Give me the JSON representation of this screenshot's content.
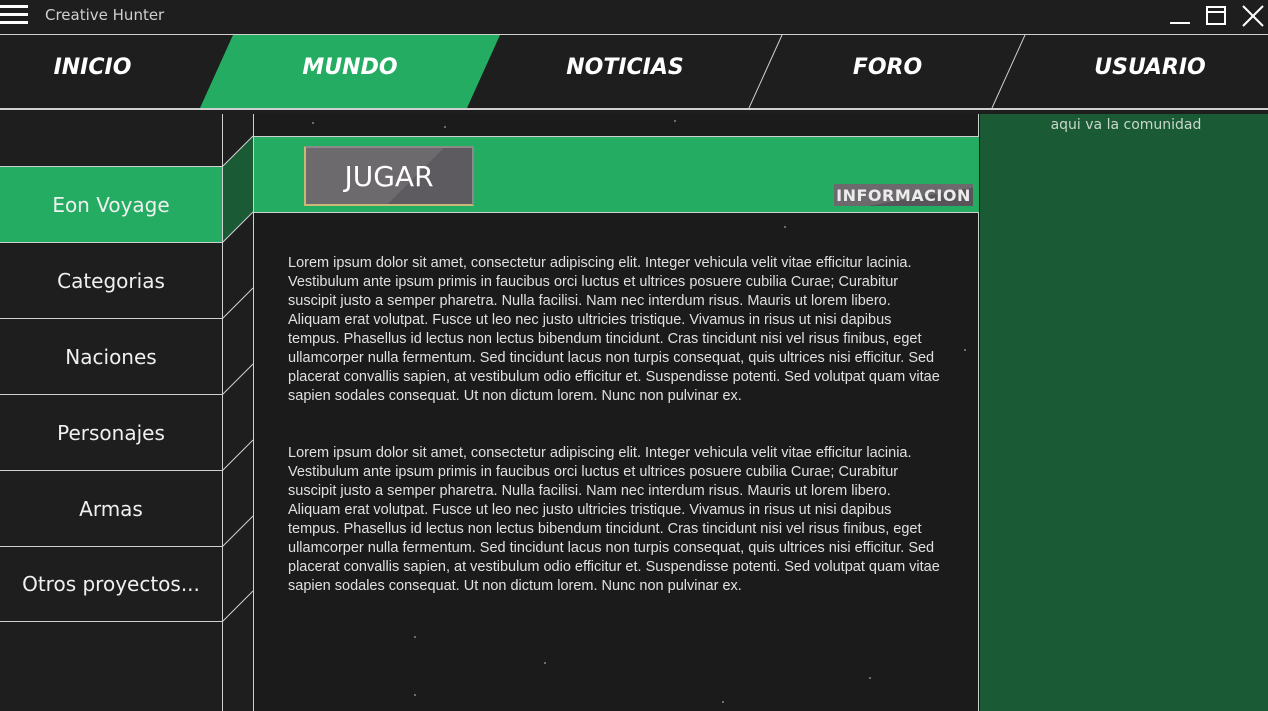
{
  "app": {
    "title": "Creative Hunter"
  },
  "nav": {
    "items": [
      {
        "label": "INICIO"
      },
      {
        "label": "MUNDO"
      },
      {
        "label": "NOTICIAS"
      },
      {
        "label": "FORO"
      },
      {
        "label": "USUARIO"
      }
    ],
    "active": "MUNDO"
  },
  "sidebar": {
    "items": [
      {
        "label": "Eon Voyage"
      },
      {
        "label": "Categorias"
      },
      {
        "label": "Naciones"
      },
      {
        "label": "Personajes"
      },
      {
        "label": "Armas"
      },
      {
        "label": "Otros proyectos..."
      }
    ],
    "active": "Eon Voyage"
  },
  "main": {
    "play_label": "JUGAR",
    "info_label": "INFORMACION",
    "paragraphs": [
      "Lorem ipsum dolor sit amet, consectetur adipiscing elit. Integer vehicula velit vitae efficitur lacinia. Vestibulum ante ipsum primis in faucibus orci luctus et ultrices posuere cubilia Curae; Curabitur suscipit justo a semper pharetra. Nulla facilisi. Nam nec interdum risus. Mauris ut lorem libero. Aliquam erat volutpat. Fusce ut leo nec justo ultricies tristique. Vivamus in risus ut nisi dapibus tempus. Phasellus id lectus non lectus bibendum tincidunt. Cras tincidunt nisi vel risus finibus, eget ullamcorper nulla fermentum. Sed tincidunt lacus non turpis consequat, quis ultrices nisi efficitur. Sed placerat convallis sapien, at vestibulum odio efficitur et. Suspendisse potenti. Sed volutpat quam vitae sapien sodales consequat. Ut non dictum lorem. Nunc non pulvinar ex.",
      "Lorem ipsum dolor sit amet, consectetur adipiscing elit. Integer vehicula velit vitae efficitur lacinia. Vestibulum ante ipsum primis in faucibus orci luctus et ultrices posuere cubilia Curae; Curabitur suscipit justo a semper pharetra. Nulla facilisi. Nam nec interdum risus. Mauris ut lorem libero. Aliquam erat volutpat. Fusce ut leo nec justo ultricies tristique. Vivamus in risus ut nisi dapibus tempus. Phasellus id lectus non lectus bibendum tincidunt. Cras tincidunt nisi vel risus finibus, eget ullamcorper nulla fermentum. Sed tincidunt lacus non turpis consequat, quis ultrices nisi efficitur. Sed placerat convallis sapien, at vestibulum odio efficitur et. Suspendisse potenti. Sed volutpat quam vitae sapien sodales consequat. Ut non dictum lorem. Nunc non pulvinar ex."
    ]
  },
  "community": {
    "text": "aqui va la comunidad"
  },
  "icons": {
    "menu": "hamburger-icon",
    "minimize": "minimize-icon",
    "maximize": "maximize-icon",
    "close": "close-icon"
  },
  "colors": {
    "accent": "#24ad62",
    "background": "#1e1e1e",
    "community_panel": "#1a5a34",
    "button_gray": "#6d6a6e"
  }
}
